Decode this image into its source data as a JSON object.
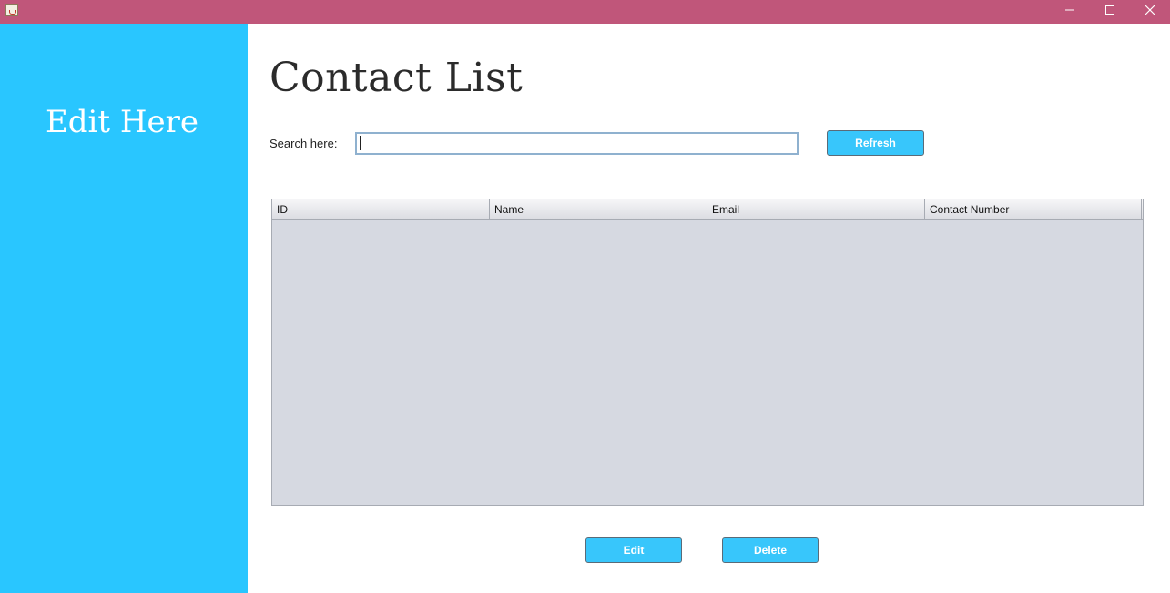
{
  "window": {
    "app_icon": "java-cup-icon",
    "controls": [
      "minimize-icon",
      "maximize-icon",
      "close-icon"
    ],
    "titlebar_color": "#c0567a"
  },
  "sidebar": {
    "title": "Edit Here",
    "color": "#29c6ff"
  },
  "main": {
    "title": "Contact List",
    "search": {
      "label": "Search here:",
      "value": "",
      "placeholder": ""
    },
    "refresh_label": "Refresh",
    "table": {
      "columns": [
        "ID",
        "Name",
        "Email",
        "Contact Number"
      ],
      "rows": []
    },
    "edit_label": "Edit",
    "delete_label": "Delete"
  }
}
